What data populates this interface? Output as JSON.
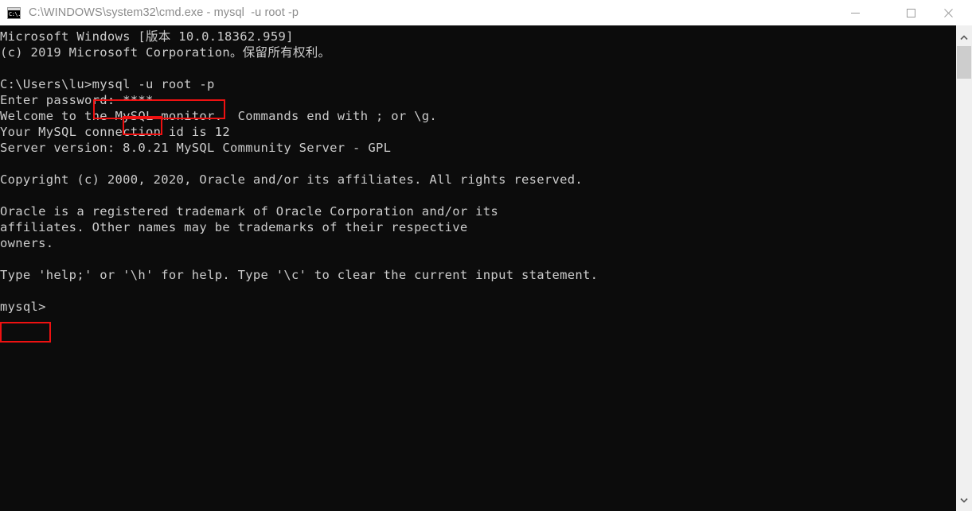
{
  "window": {
    "title": "C:\\WINDOWS\\system32\\cmd.exe - mysql  -u root -p",
    "icon": "cmd-console-icon",
    "icon_glyph": "C:\\.",
    "background_color": "#0c0c0c",
    "text_color": "#cccccc",
    "titlebar_color": "#ffffff"
  },
  "window_controls": {
    "minimize_label": "Minimize",
    "maximize_label": "Maximize",
    "close_label": "Close"
  },
  "console": {
    "lines": [
      "Microsoft Windows [版本 10.0.18362.959]",
      "(c) 2019 Microsoft Corporation。保留所有权利。",
      "",
      "C:\\Users\\lu>mysql -u root -p",
      "Enter password: ****",
      "Welcome to the MySQL monitor.  Commands end with ; or \\g.",
      "Your MySQL connection id is 12",
      "Server version: 8.0.21 MySQL Community Server - GPL",
      "",
      "Copyright (c) 2000, 2020, Oracle and/or its affiliates. All rights reserved.",
      "",
      "Oracle is a registered trademark of Oracle Corporation and/or its",
      "affiliates. Other names may be trademarks of their respective",
      "owners.",
      "",
      "Type 'help;' or '\\h' for help. Type '\\c' to clear the current input statement.",
      "",
      "mysql>"
    ],
    "prompt_path": "C:\\Users\\lu>",
    "command_entered": "mysql -u root -p",
    "password_masked": "****",
    "mysql_connection_id": "12",
    "mysql_server_version": "8.0.21 MySQL Community Server - GPL",
    "mysql_prompt": "mysql>"
  },
  "annotations": {
    "accent_color": "#ee1111",
    "boxes": [
      {
        "name": "command-highlight",
        "target": "mysql -u root -p"
      },
      {
        "name": "password-highlight",
        "target": "****"
      },
      {
        "name": "prompt-highlight",
        "target": "mysql>"
      }
    ]
  },
  "scrollbar": {
    "up_arrow": "chevron-up-icon",
    "down_arrow": "chevron-down-icon",
    "thumb_color": "#cdcdcd",
    "track_color": "#f0f0f0"
  }
}
